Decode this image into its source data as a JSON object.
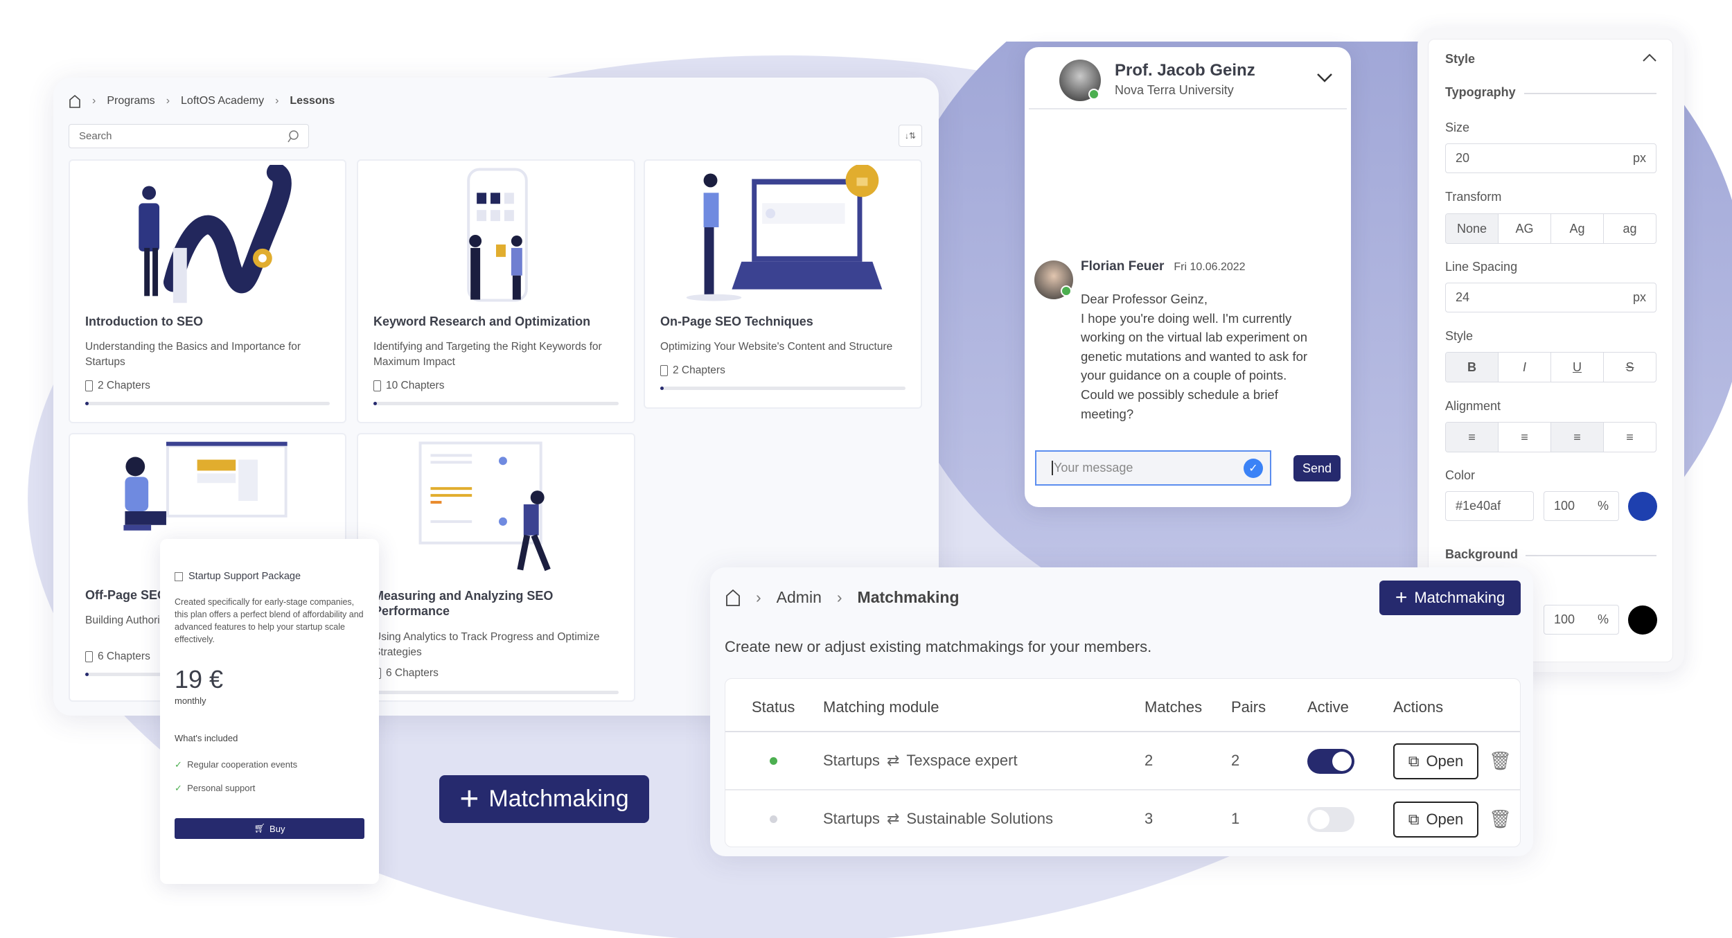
{
  "lessons": {
    "breadcrumb": [
      "Programs",
      "LoftOS Academy",
      "Lessons"
    ],
    "search_placeholder": "Search",
    "cards": [
      {
        "title": "Introduction to SEO",
        "description": "Understanding the Basics and Importance for Startups",
        "chapters": "2 Chapters",
        "progress": 0.01
      },
      {
        "title": "Keyword Research and Optimization",
        "description": "Identifying and Targeting the Right Keywords for Maximum Impact",
        "chapters": "10 Chapters",
        "progress": 0.01
      },
      {
        "title": "On-Page SEO Techniques",
        "description": "Optimizing Your Website's Content and Structure",
        "chapters": "2 Chapters",
        "progress": 0.01
      },
      {
        "title": "Off-Page SEO",
        "description": "Building Authority Rankings",
        "chapters": "6 Chapters",
        "progress": 0.01
      },
      {
        "title": "Measuring and Analyzing SEO Performance",
        "description": "Using Analytics to Track Progress and Optimize Strategies",
        "chapters": "6 Chapters",
        "progress": 0
      }
    ]
  },
  "pricing": {
    "title": "Startup Support Package",
    "description": "Created specifically for early-stage companies, this plan offers a perfect blend of affordability and advanced features to help your startup scale effectively.",
    "price": "19 €",
    "period": "monthly",
    "included_heading": "What's included",
    "features": [
      "Regular cooperation events",
      "Personal support"
    ],
    "buy_label": "Buy"
  },
  "big_button": {
    "label": "Matchmaking"
  },
  "chat": {
    "contact_name": "Prof. Jacob Geinz",
    "contact_org": "Nova Terra University",
    "message": {
      "author": "Florian Feuer",
      "date": "Fri 10.06.2022",
      "lines": [
        "Dear Professor Geinz,",
        "I hope you're doing well. I'm currently",
        "working on the virtual lab experiment on",
        "genetic mutations and wanted to ask for",
        "your guidance on a couple of points.",
        "Could we possibly schedule a brief",
        "meeting?"
      ]
    },
    "input_placeholder": "Your message",
    "send_label": "Send"
  },
  "style_panel": {
    "title": "Style",
    "typography_heading": "Typography",
    "size_label": "Size",
    "size_value": "20",
    "size_unit": "px",
    "transform_label": "Transform",
    "transform_options": [
      "None",
      "AG",
      "Ag",
      "ag"
    ],
    "line_spacing_label": "Line Spacing",
    "line_spacing_value": "24",
    "line_spacing_unit": "px",
    "style_label": "Style",
    "style_options": [
      "B",
      "I",
      "U",
      "S"
    ],
    "alignment_label": "Alignment",
    "color_label": "Color",
    "color_hex": "#1e40af",
    "color_opacity": "100",
    "opacity_unit": "%",
    "color_swatch": "#1e40af",
    "background_heading": "Background",
    "background_opacity": "100",
    "background_swatch": "#000000"
  },
  "matchmaking": {
    "breadcrumb": [
      "Admin",
      "Matchmaking"
    ],
    "add_label": "Matchmaking",
    "description": "Create new or adjust existing matchmakings for your members.",
    "columns": [
      "Status",
      "Matching module",
      "Matches",
      "Pairs",
      "Active",
      "Actions"
    ],
    "rows": [
      {
        "status_color": "#4caf50",
        "from": "Startups",
        "to": "Texspace expert",
        "matches": "2",
        "pairs": "2",
        "active": true,
        "open_label": "Open"
      },
      {
        "status_color": "#d4d5dc",
        "from": "Startups",
        "to": "Sustainable Solutions",
        "matches": "3",
        "pairs": "1",
        "active": false,
        "open_label": "Open"
      }
    ]
  },
  "colors": {
    "navy": "#262a6e",
    "online": "#4caf50",
    "lavender": "#dfe1f2",
    "periwinkle": "#a4aad8"
  }
}
